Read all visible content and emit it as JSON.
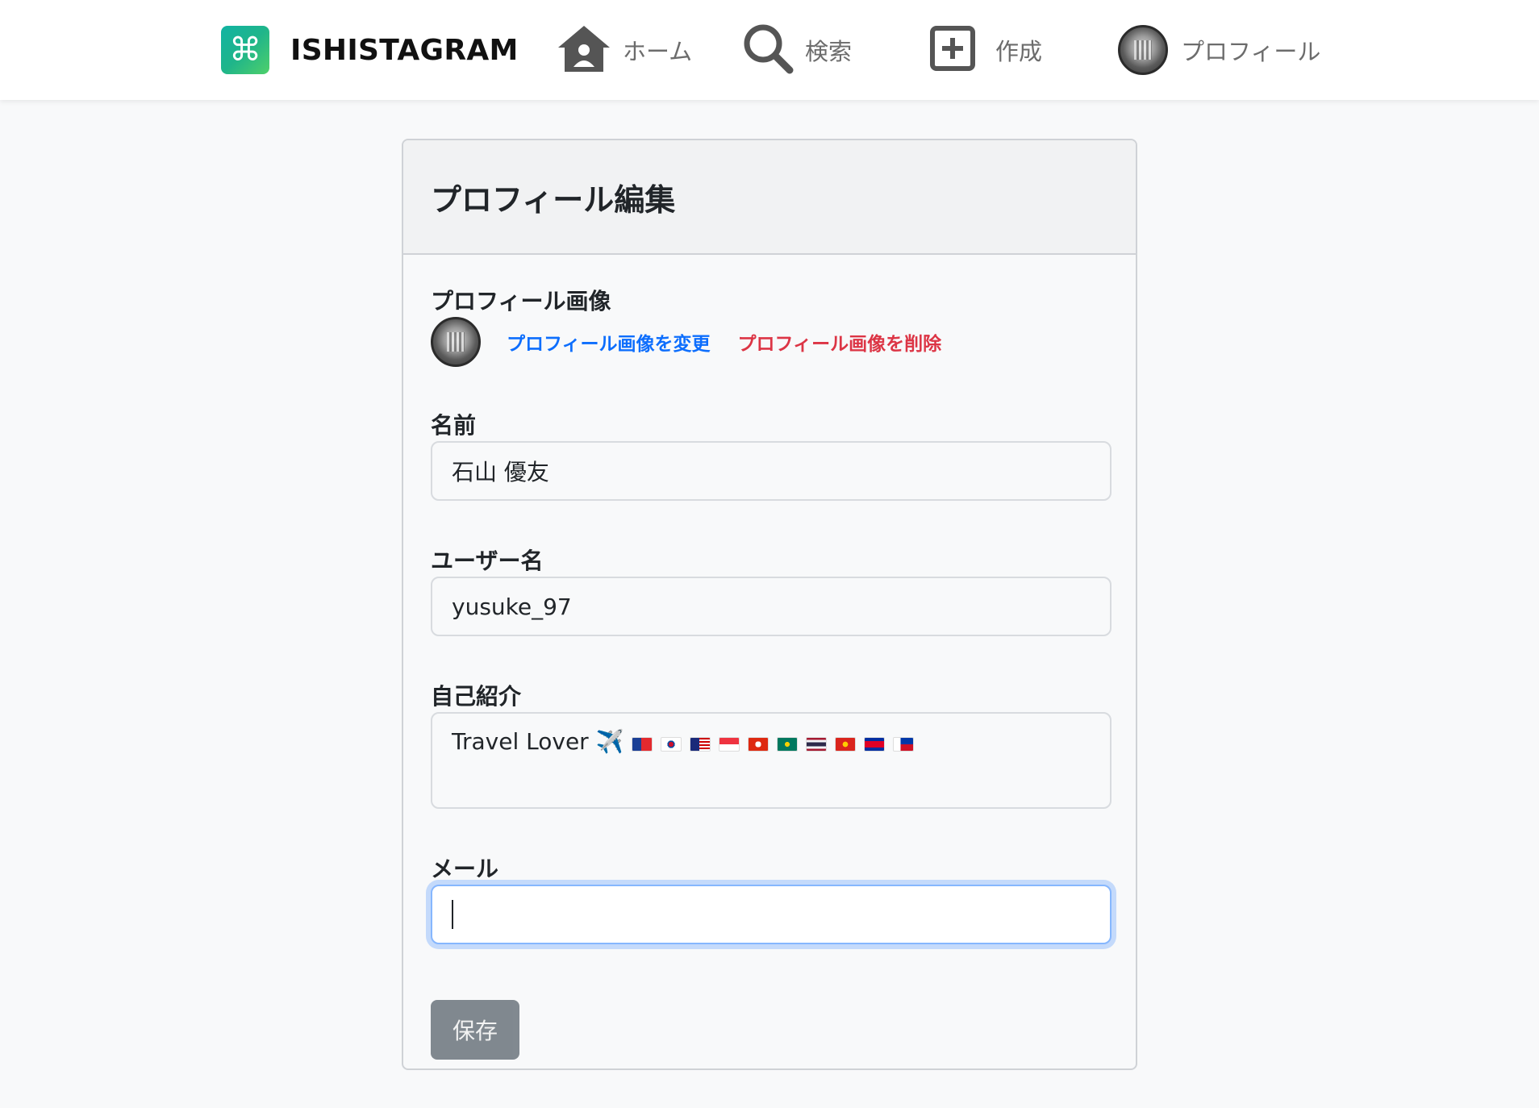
{
  "nav": {
    "brand": "ISHISTAGRAM",
    "brand_glyph": "⌘",
    "items": [
      {
        "label": "ホーム",
        "icon": "home-icon"
      },
      {
        "label": "検索",
        "icon": "search-icon"
      },
      {
        "label": "作成",
        "icon": "plus-square-icon"
      },
      {
        "label": "プロフィール",
        "icon": "avatar"
      }
    ]
  },
  "card": {
    "title": "プロフィール編集",
    "profile_image": {
      "label": "プロフィール画像",
      "change_link": "プロフィール画像を変更",
      "delete_link": "プロフィール画像を削除"
    },
    "name": {
      "label": "名前",
      "value": "石山 優友"
    },
    "username": {
      "label": "ユーザー名",
      "value": "yusuke_97"
    },
    "bio": {
      "label": "自己紹介",
      "text": "Travel Lover ✈️",
      "flags": [
        "taiwan-flag",
        "korea-flag",
        "malaysia-flag",
        "singapore-flag",
        "hong-kong-flag",
        "macau-flag",
        "thailand-flag",
        "vietnam-flag",
        "cambodia-flag",
        "philippines-flag"
      ]
    },
    "email": {
      "label": "メール",
      "value": ""
    },
    "save_label": "保存"
  },
  "colors": {
    "link_blue": "#0d6efd",
    "link_red": "#dc3545",
    "save_button": "#6c757d",
    "focus_ring": "#86b7fe"
  }
}
